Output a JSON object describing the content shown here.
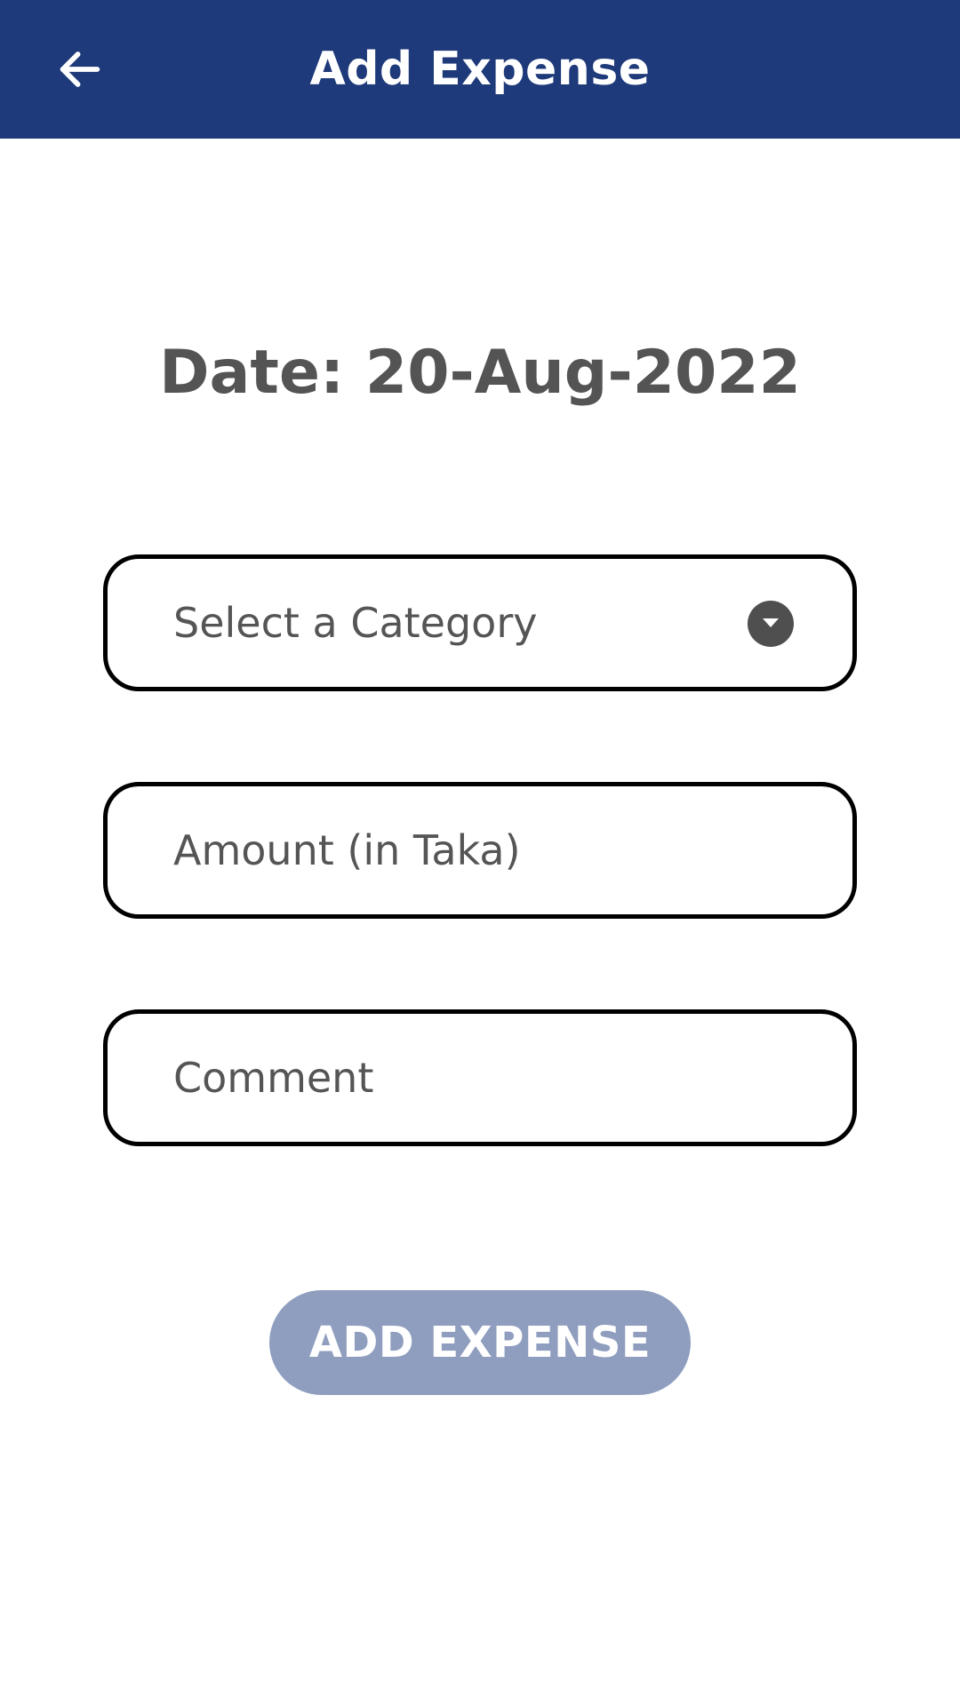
{
  "app_bar": {
    "title": "Add Expense",
    "back_icon": "arrow-left-icon",
    "background_color": "#1f3a7a"
  },
  "date": {
    "text": "Date: 20-Aug-2022"
  },
  "form": {
    "category": {
      "placeholder": "Select a Category",
      "icon": "dropdown-circle-icon"
    },
    "amount": {
      "placeholder": "Amount (in Taka)"
    },
    "comment": {
      "placeholder": "Comment"
    }
  },
  "submit": {
    "label": "ADD EXPENSE",
    "color": "#8f9ebf"
  }
}
